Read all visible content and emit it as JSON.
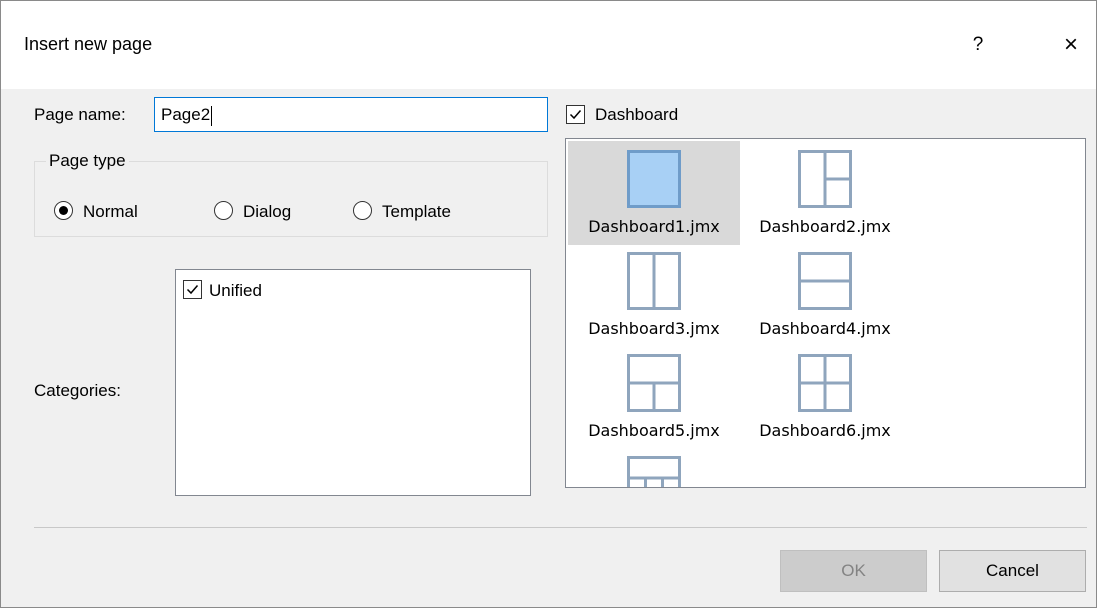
{
  "window": {
    "title": "Insert new page",
    "help_label": "?",
    "close_label": "×"
  },
  "form": {
    "page_name_label": "Page name:",
    "page_name_value": "Page2",
    "page_type_title": "Page type",
    "page_types": [
      {
        "label": "Normal",
        "selected": true
      },
      {
        "label": "Dialog",
        "selected": false
      },
      {
        "label": "Template",
        "selected": false
      }
    ],
    "categories_label": "Categories:",
    "categories": [
      {
        "label": "Unified",
        "checked": true
      }
    ]
  },
  "dashboard": {
    "checkbox_label": "Dashboard",
    "checked": true,
    "items": [
      {
        "label": "Dashboard1.jmx",
        "layout": "single",
        "selected": true
      },
      {
        "label": "Dashboard2.jmx",
        "layout": "left-col-right-two"
      },
      {
        "label": "Dashboard3.jmx",
        "layout": "two-columns"
      },
      {
        "label": "Dashboard4.jmx",
        "layout": "top-bottom"
      },
      {
        "label": "Dashboard5.jmx",
        "layout": "top-bottom-split"
      },
      {
        "label": "Dashboard6.jmx",
        "layout": "grid-four"
      },
      {
        "label": "",
        "layout": "top-bottom-three"
      }
    ],
    "scroll_up": "^",
    "scroll_down": "v"
  },
  "buttons": {
    "ok_label": "OK",
    "cancel_label": "Cancel"
  },
  "colors": {
    "focus_border": "#0078d7",
    "selection": "#d9d9d9",
    "icon_stroke": "#8fa5bd",
    "icon_selected_fill": "#a8d0f5"
  }
}
